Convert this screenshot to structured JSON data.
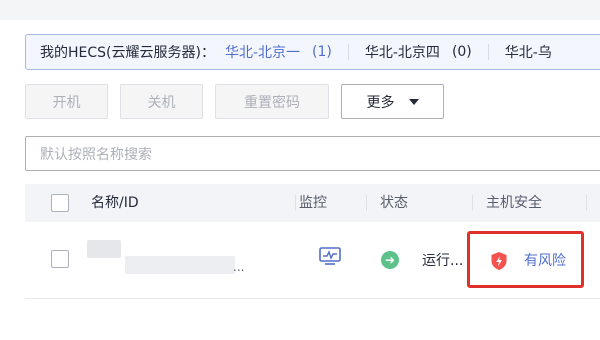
{
  "region_bar": {
    "label": "我的HECS(云耀云服务器)：",
    "items": [
      {
        "name": "华北-北京一",
        "count": "(1)",
        "active": true
      },
      {
        "name": "华北-北京四",
        "count": "(0)",
        "active": false
      },
      {
        "name": "华北-乌",
        "count": "",
        "active": false
      }
    ]
  },
  "toolbar": {
    "start_label": "开机",
    "stop_label": "关机",
    "reset_password_label": "重置密码",
    "more_label": "更多"
  },
  "search": {
    "placeholder": "默认按照名称搜索"
  },
  "table": {
    "headers": {
      "name": "名称/ID",
      "monitor": "监控",
      "status": "状态",
      "host_security": "主机安全"
    },
    "rows": [
      {
        "name_suffix": "...",
        "status": "运行...",
        "host_security": "有风险"
      }
    ]
  },
  "colors": {
    "link": "#526ecc",
    "danger": "#e0302a",
    "running": "#5cc28a"
  },
  "icons": {
    "monitor": "monitor-icon",
    "status": "arrow-right-circle-icon",
    "security": "shield-lightning-icon"
  }
}
